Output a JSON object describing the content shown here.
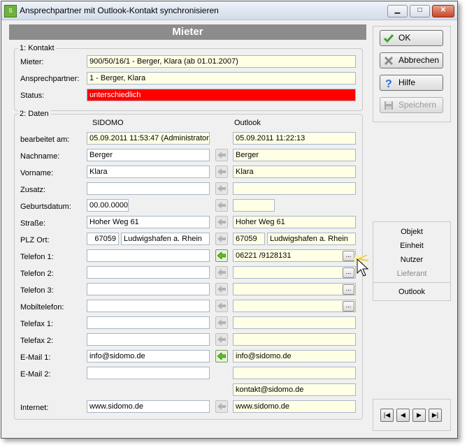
{
  "window": {
    "title": "Ansprechpartner mit Outlook-Kontakt synchronisieren",
    "minimize_label": "▁",
    "maximize_label": "□",
    "close_label": "✕",
    "app_icon": "app-icon"
  },
  "header": {
    "title": "Mieter"
  },
  "kontakt": {
    "legend": "1: Kontakt",
    "mieter_label": "Mieter:",
    "mieter_value": "900/50/16/1 - Berger, Klara  (ab 01.01.2007)",
    "ansprech_label": "Ansprechpartner:",
    "ansprech_value": "1 - Berger, Klara",
    "status_label": "Status:",
    "status_value": "unterschiedlich",
    "status_color": "#ff0000"
  },
  "daten": {
    "legend": "2: Daten",
    "col_left": "SIDOMO",
    "col_right": "Outlook",
    "rows": {
      "bearbeitet": {
        "label": "bearbeitet am:",
        "left": "05.09.2011 11:53:47 (Administrator)",
        "right": "05.09.2011 11:22:13"
      },
      "nachname": {
        "label": "Nachname:",
        "left": "Berger",
        "right": "Berger"
      },
      "vorname": {
        "label": "Vorname:",
        "left": "Klara",
        "right": "Klara"
      },
      "zusatz": {
        "label": "Zusatz:",
        "left": "",
        "right": ""
      },
      "geburtsdatum": {
        "label": "Geburtsdatum:",
        "left": "00.00.0000",
        "right": ""
      },
      "strasse": {
        "label": "Straße:",
        "left": "Hoher Weg 61",
        "right": "Hoher Weg 61"
      },
      "plz": {
        "label": "PLZ Ort:",
        "left_plz": "67059",
        "left_ort": "Ludwigshafen a. Rhein",
        "right_plz": "67059",
        "right_ort": "Ludwigshafen a. Rhein"
      },
      "telefon1": {
        "label": "Telefon 1:",
        "left": "",
        "right": "06221 /9128131"
      },
      "telefon2": {
        "label": "Telefon 2:",
        "left": "",
        "right": ""
      },
      "telefon3": {
        "label": "Telefon 3:",
        "left": "",
        "right": ""
      },
      "mobil": {
        "label": "Mobiltelefon:",
        "left": "",
        "right": ""
      },
      "telefax1": {
        "label": "Telefax 1:",
        "left": "",
        "right": ""
      },
      "telefax2": {
        "label": "Telefax 2:",
        "left": "",
        "right": ""
      },
      "email1": {
        "label": "E-Mail 1:",
        "left": "info@sidomo.de",
        "right": "info@sidomo.de"
      },
      "email2": {
        "label": "E-Mail 2:",
        "left": "",
        "right": ""
      },
      "email_extra": {
        "right": "kontakt@sidomo.de"
      },
      "internet": {
        "label": "Internet:",
        "left": "www.sidomo.de",
        "right": "www.sidomo.de"
      }
    },
    "dots_label": "...",
    "active_arrow_color": "#5cc21a"
  },
  "buttons": {
    "ok": "OK",
    "abbrechen": "Abbrechen",
    "hilfe": "Hilfe",
    "speichern": "Speichern"
  },
  "nav": {
    "objekt": "Objekt",
    "einheit": "Einheit",
    "nutzer": "Nutzer",
    "lieferant": "Lieferant",
    "outlook": "Outlook",
    "first": "|◀",
    "prev": "◀",
    "next": "▶",
    "last": "▶|"
  }
}
